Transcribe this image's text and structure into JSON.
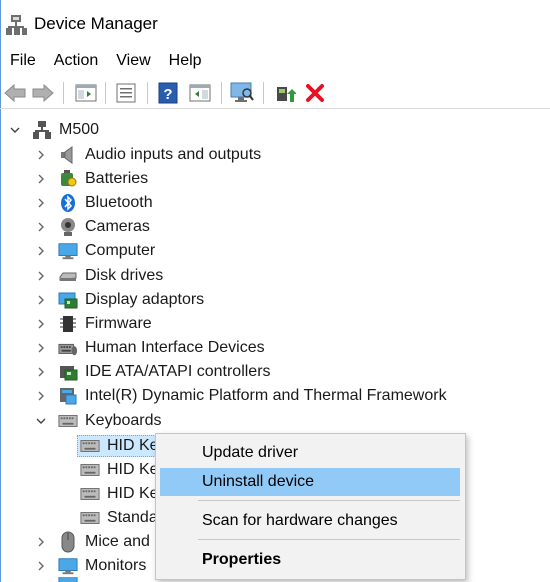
{
  "window": {
    "title": "Device Manager"
  },
  "menubar": {
    "items": [
      "File",
      "Action",
      "View",
      "Help"
    ]
  },
  "toolbar": {
    "buttons": [
      "back-arrow-icon",
      "forward-arrow-icon",
      "show-hide-console-tree-icon",
      "properties-icon",
      "help-icon",
      "action-pane-icon",
      "scan-hardware-icon",
      "update-driver-icon",
      "uninstall-device-icon"
    ]
  },
  "tree": {
    "root": "M500",
    "categories": [
      {
        "label": "Audio inputs and outputs",
        "icon": "speaker-icon",
        "expanded": false
      },
      {
        "label": "Batteries",
        "icon": "battery-icon",
        "expanded": false
      },
      {
        "label": "Bluetooth",
        "icon": "bluetooth-icon",
        "expanded": false
      },
      {
        "label": "Cameras",
        "icon": "camera-icon",
        "expanded": false
      },
      {
        "label": "Computer",
        "icon": "monitor-icon",
        "expanded": false
      },
      {
        "label": "Disk drives",
        "icon": "disk-drive-icon",
        "expanded": false
      },
      {
        "label": "Display adaptors",
        "icon": "display-adapter-icon",
        "expanded": false
      },
      {
        "label": "Firmware",
        "icon": "chip-icon",
        "expanded": false
      },
      {
        "label": "Human Interface Devices",
        "icon": "hid-icon",
        "expanded": false
      },
      {
        "label": "IDE ATA/ATAPI controllers",
        "icon": "ide-controller-icon",
        "expanded": false
      },
      {
        "label": "Intel(R) Dynamic Platform and Thermal Framework",
        "icon": "thermal-framework-icon",
        "expanded": false
      },
      {
        "label": "Keyboards",
        "icon": "keyboard-icon",
        "expanded": true
      }
    ],
    "keyboard_children": [
      "HID Ke",
      "HID Ke",
      "HID Ke",
      "Standa"
    ],
    "after_categories": [
      {
        "label": "Mice and c",
        "icon": "mouse-icon",
        "expanded": false
      },
      {
        "label": "Monitors",
        "icon": "monitor-icon",
        "expanded": false
      }
    ]
  },
  "context_menu": {
    "items": [
      "Update driver",
      "Uninstall device",
      "Scan for hardware changes",
      "Properties"
    ],
    "highlighted": "Uninstall device"
  },
  "colors": {
    "selection": "#cce8ff",
    "menu_highlight": "#91c9f7",
    "uninstall_red": "#e81123"
  }
}
